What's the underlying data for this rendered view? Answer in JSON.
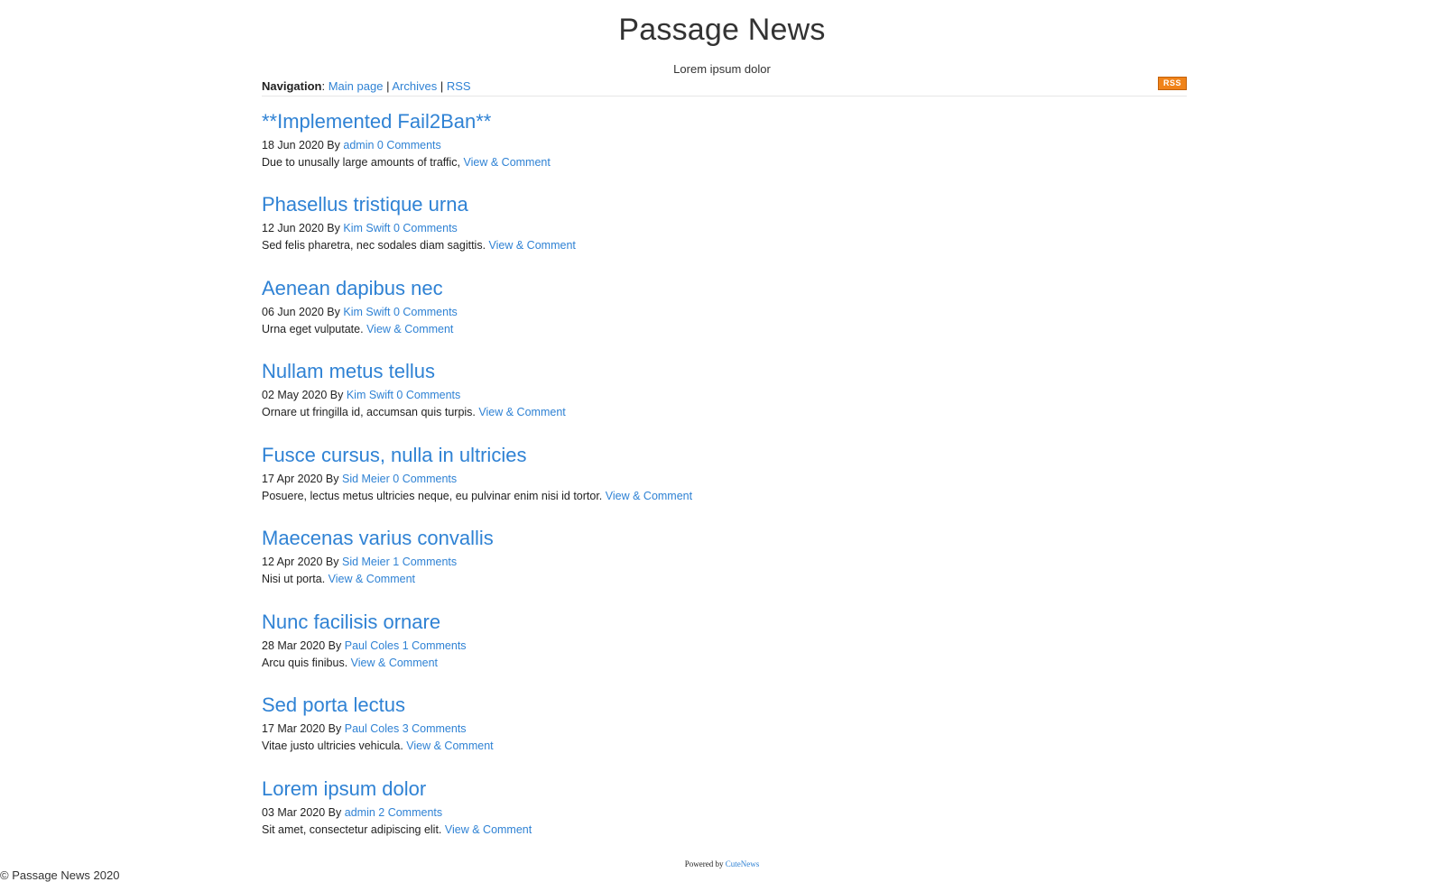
{
  "site": {
    "title": "Passage News",
    "tagline": "Lorem ipsum dolor"
  },
  "nav": {
    "label": "Navigation",
    "colon": ":",
    "separator": "|",
    "links": [
      "Main page",
      "Archives",
      "RSS"
    ],
    "rss_badge": "RSS"
  },
  "posts": [
    {
      "title": "**Implemented Fail2Ban**",
      "date": "18 Jun 2020",
      "by": "By",
      "author": "admin",
      "comments": "0 Comments",
      "excerpt": "Due to unusally large amounts of traffic,",
      "link": "View & Comment"
    },
    {
      "title": "Phasellus tristique urna",
      "date": "12 Jun 2020",
      "by": "By",
      "author": "Kim Swift",
      "comments": "0 Comments",
      "excerpt": "Sed felis pharetra, nec sodales diam sagittis.",
      "link": "View & Comment"
    },
    {
      "title": "Aenean dapibus nec",
      "date": "06 Jun 2020",
      "by": "By",
      "author": "Kim Swift",
      "comments": "0 Comments",
      "excerpt": "Urna eget vulputate.",
      "link": "View & Comment"
    },
    {
      "title": "Nullam metus tellus",
      "date": "02 May 2020",
      "by": "By",
      "author": "Kim Swift",
      "comments": "0 Comments",
      "excerpt": "Ornare ut fringilla id, accumsan quis turpis.",
      "link": "View & Comment"
    },
    {
      "title": "Fusce cursus, nulla in ultricies",
      "date": "17 Apr 2020",
      "by": "By",
      "author": "Sid Meier",
      "comments": "0 Comments",
      "excerpt": "Posuere, lectus metus ultricies neque, eu pulvinar enim nisi id tortor.",
      "link": "View & Comment"
    },
    {
      "title": "Maecenas varius convallis",
      "date": "12 Apr 2020",
      "by": "By",
      "author": "Sid Meier",
      "comments": "1 Comments",
      "excerpt": "Nisi ut porta.",
      "link": "View & Comment"
    },
    {
      "title": "Nunc facilisis ornare",
      "date": "28 Mar 2020",
      "by": "By",
      "author": "Paul Coles",
      "comments": "1 Comments",
      "excerpt": "Arcu quis finibus.",
      "link": "View & Comment"
    },
    {
      "title": "Sed porta lectus",
      "date": "17 Mar 2020",
      "by": "By",
      "author": "Paul Coles",
      "comments": "3 Comments",
      "excerpt": "Vitae justo ultricies vehicula.",
      "link": "View & Comment"
    },
    {
      "title": "Lorem ipsum dolor",
      "date": "03 Mar 2020",
      "by": "By",
      "author": "admin",
      "comments": "2 Comments",
      "excerpt": "Sit amet, consectetur adipiscing elit.",
      "link": "View & Comment"
    }
  ],
  "footer": {
    "powered_prefix": "Powered by",
    "powered_link": "CuteNews",
    "copyright": "© Passage News 2020"
  },
  "colors": {
    "link": "#2f82d4",
    "text": "#222222",
    "rss_badge": "#f08319"
  }
}
